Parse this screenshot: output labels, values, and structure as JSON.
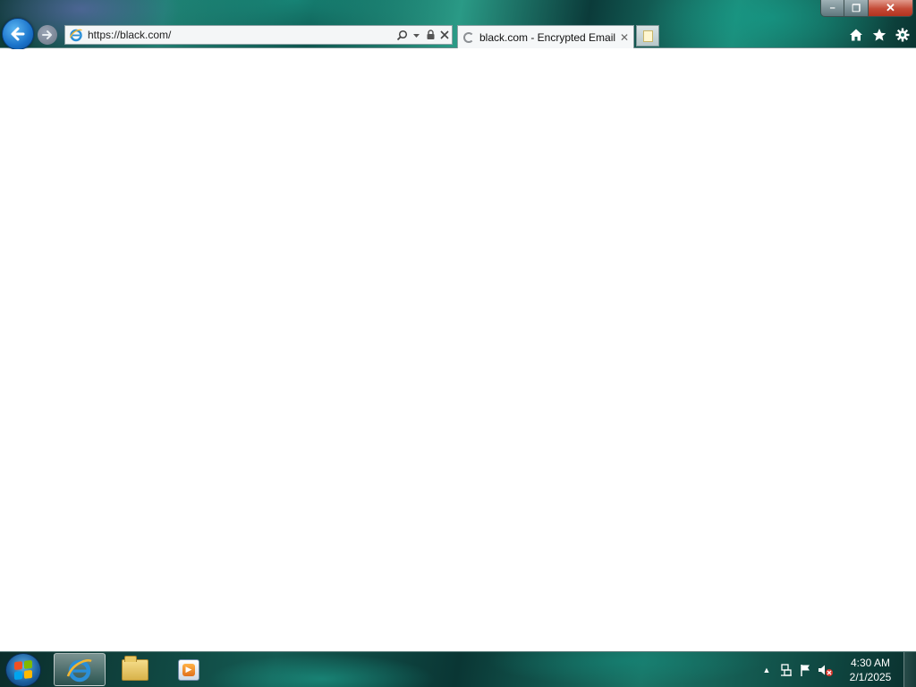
{
  "window": {
    "minimize_label": "–",
    "restore_label": "❐",
    "close_label": "✕"
  },
  "nav": {
    "back_icon": "back-arrow-icon",
    "forward_icon": "forward-arrow-icon"
  },
  "address": {
    "url": "https://black.com/",
    "search_icon": "search-icon",
    "dropdown_icon": "chevron-down-icon",
    "lock_icon": "lock-icon",
    "stop_icon": "close-icon"
  },
  "tabs": [
    {
      "title": "black.com - Encrypted Email",
      "loading": true,
      "close_label": "✕"
    }
  ],
  "toolbar": {
    "home_icon": "home-icon",
    "favorites_icon": "star-icon",
    "tools_icon": "gear-icon"
  },
  "taskbar": {
    "pinned": [
      "internet-explorer",
      "windows-explorer",
      "windows-media-player"
    ],
    "clock": {
      "time": "4:30 AM",
      "date": "2/1/2025"
    }
  },
  "colors": {
    "start_flag": [
      "#f25022",
      "#7fba00",
      "#00a4ef",
      "#ffb900"
    ],
    "close_button": "#c44a36",
    "back_button": "#1a72c9"
  }
}
